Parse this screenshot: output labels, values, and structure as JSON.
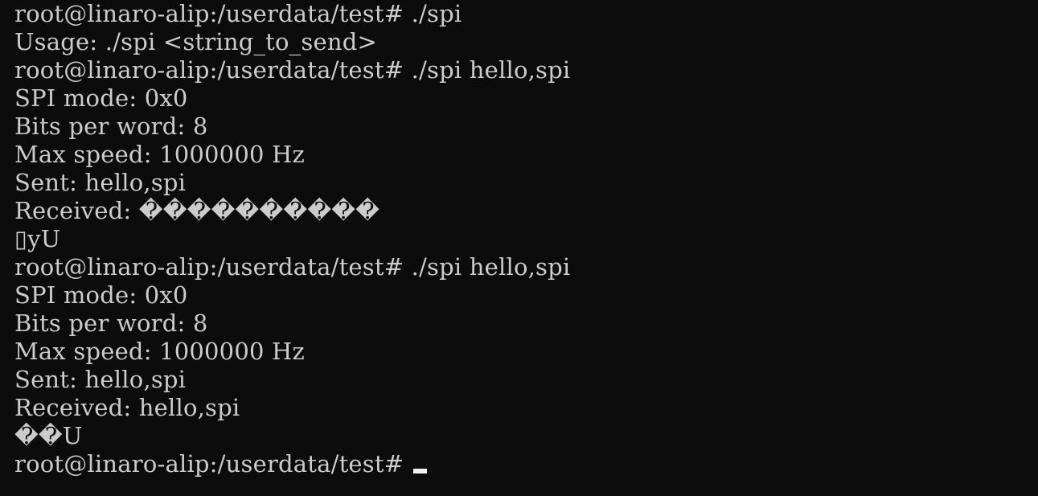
{
  "terminal": {
    "lines": [
      "root@linaro-alip:/userdata/test# ./spi",
      "Usage: ./spi <string_to_send>",
      "root@linaro-alip:/userdata/test# ./spi hello,spi",
      "SPI mode: 0x0",
      "Bits per word: 8",
      "Max speed: 1000000 Hz",
      "Sent: hello,spi",
      "Received: ����������",
      "▯yU",
      "root@linaro-alip:/userdata/test# ./spi hello,spi",
      "SPI mode: 0x0",
      "Bits per word: 8",
      "Max speed: 1000000 Hz",
      "Sent: hello,spi",
      "Received: hello,spi",
      "��U",
      "root@linaro-alip:/userdata/test# "
    ]
  }
}
